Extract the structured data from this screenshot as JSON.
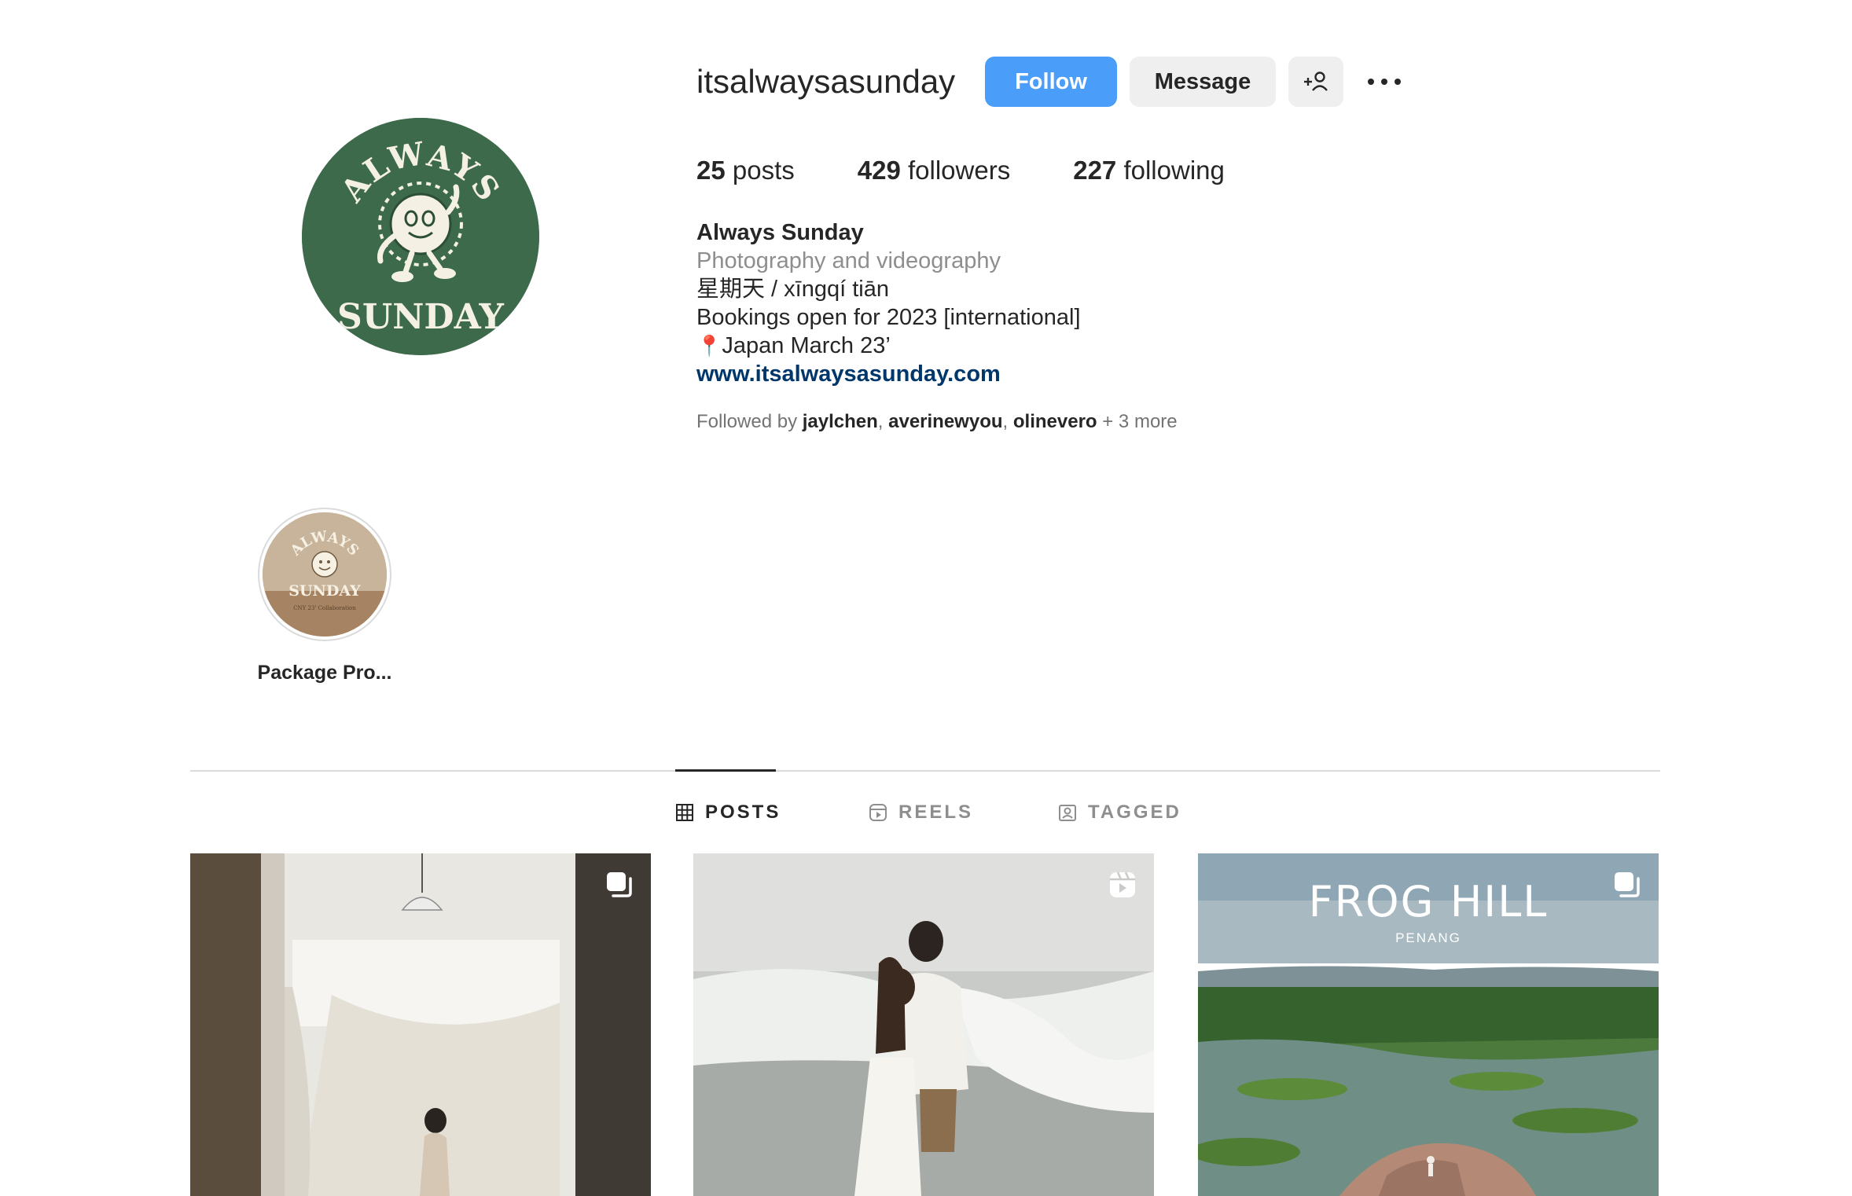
{
  "profile": {
    "username": "itsalwaysasunday",
    "avatar_text_top": "ALWAYS",
    "avatar_text_bottom": "SUNDAY",
    "avatar_color": "#3d6a4a"
  },
  "actions": {
    "follow_label": "Follow",
    "message_label": "Message",
    "add_user_icon": "add-person-icon",
    "more_icon": "more-horizontal-icon",
    "accent_color": "#4a9df8"
  },
  "stats": {
    "posts_count": "25",
    "posts_label": "posts",
    "followers_count": "429",
    "followers_label": "followers",
    "following_count": "227",
    "following_label": "following"
  },
  "bio": {
    "name": "Always Sunday",
    "category": "Photography and videography",
    "line1": "星期天 / xīngqí tiān",
    "line2": "Bookings open for 2023 [international]",
    "pin_icon": "📍",
    "line3": "Japan March 23’",
    "link": "www.itsalwaysasunday.com"
  },
  "followed_by": {
    "prefix": "Followed by",
    "users": [
      "jaylchen",
      "averinewyou",
      "olinevero"
    ],
    "more": "+ 3 more"
  },
  "highlights": [
    {
      "label": "Package Pro...",
      "thumb_text_top": "ALWAYS",
      "thumb_text_bottom": "SUNDAY",
      "thumb_caption": "CNY 23' Collaboration"
    }
  ],
  "tabs": [
    {
      "label": "POSTS",
      "icon": "grid-icon",
      "active": true
    },
    {
      "label": "REELS",
      "icon": "reels-icon",
      "active": false
    },
    {
      "label": "TAGGED",
      "icon": "tagged-icon",
      "active": false
    }
  ],
  "posts": [
    {
      "type": "carousel",
      "badge_icon": "carousel-icon"
    },
    {
      "type": "reel",
      "badge_icon": "reel-icon"
    },
    {
      "type": "carousel",
      "badge_icon": "carousel-icon",
      "title": "FROG HILL",
      "subtitle": "PENANG"
    }
  ]
}
